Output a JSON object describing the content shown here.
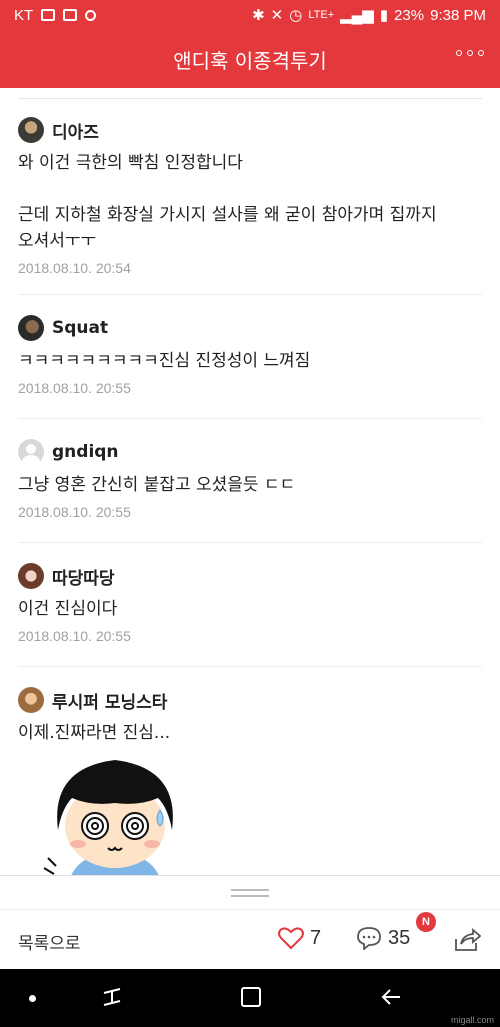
{
  "status_bar": {
    "carrier": "KT",
    "network": "LTE+",
    "battery": "23%",
    "time": "9:38 PM"
  },
  "app_bar": {
    "title": "앤디훅 이종격투기"
  },
  "comments": [
    {
      "nick": "디아즈",
      "lines": [
        "와 이건 극한의 빡침 인정합니다",
        "",
        "근데 지하철 화장실 가시지 설사를 왜 굳이 참아가며 집까지",
        "오셔서ㅜㅜ"
      ],
      "date": "2018.08.10. 20:54"
    },
    {
      "nick": "Squat",
      "lines": [
        "ㅋㅋㅋㅋㅋㅋㅋㅋㅋ진심 진정성이 느껴짐"
      ],
      "date": "2018.08.10. 20:55"
    },
    {
      "nick": "gndiqn",
      "lines": [
        "그냥 영혼 간신히 붙잡고 오셨을듯 ㄷㄷ"
      ],
      "date": "2018.08.10. 20:55"
    },
    {
      "nick": "따당따당",
      "lines": [
        "이건 진심이다"
      ],
      "date": "2018.08.10. 20:55"
    },
    {
      "nick": "루시퍼 모닝스타",
      "lines": [
        "이제.진짜라면 진심..."
      ],
      "date": ""
    }
  ],
  "toolbar": {
    "list_label": "목록으로",
    "like_count": "7",
    "comment_count": "35",
    "new_badge": "N"
  },
  "watermark": "migall.com",
  "icons": {
    "like": "heart-icon",
    "comment": "speech-bubble-icon",
    "share": "share-icon",
    "more": "more-dots-icon"
  },
  "colors": {
    "brand": "#e4393c",
    "date_text": "#a0a0a0"
  }
}
